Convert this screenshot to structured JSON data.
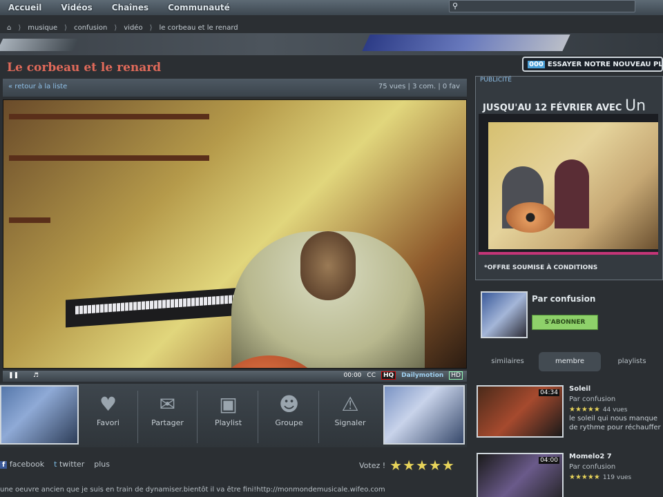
{
  "topnav": {
    "items": [
      "Accueil",
      "Vidéos",
      "Chaînes",
      "Communauté"
    ]
  },
  "search": {
    "placeholder": ""
  },
  "breadcrumb": [
    "musique",
    "confusion",
    "vidéo",
    "le corbeau et le renard"
  ],
  "video": {
    "title": "Le corbeau et le renard",
    "back_link": "« retour à la liste",
    "stats": "75 vues | 3 com. | 0 fav"
  },
  "player": {
    "time": "00:00",
    "cc": "CC",
    "hq": "HQ",
    "brand": "Dailymotion",
    "hd": "HD"
  },
  "actions": [
    {
      "label": "Favori",
      "icon": "heart-icon"
    },
    {
      "label": "Partager",
      "icon": "envelope-icon"
    },
    {
      "label": "Playlist",
      "icon": "playlist-icon"
    },
    {
      "label": "Groupe",
      "icon": "group-icon"
    },
    {
      "label": "Signaler",
      "icon": "warning-icon"
    }
  ],
  "social": {
    "facebook": "facebook",
    "twitter": "twitter",
    "plus": "plus"
  },
  "vote": {
    "label": "Votez !",
    "rating": 5
  },
  "description": "une oeuvre ancien que je suis en train de dynamiser.bientôt il va être fini!http://monmondemusicale.wifeo.com",
  "promo": {
    "tag": "000",
    "text": "ESSAYER NOTRE NOUVEAU PL"
  },
  "ad": {
    "label": "PUBLICITÉ",
    "headline": "JUSQU'AU 12 FÉVRIER AVEC",
    "brand": "Un",
    "footnote": "*OFFRE SOUMISE À CONDITIONS"
  },
  "owner": {
    "by": "Par confusion",
    "subscribe": "S'ABONNER"
  },
  "tabs": [
    {
      "label": "similaires",
      "active": false
    },
    {
      "label": "membre",
      "active": true
    },
    {
      "label": "playlists",
      "active": false
    }
  ],
  "related": [
    {
      "name": "Soleil",
      "by": "Par confusion",
      "views": "44 vues",
      "text": "le soleil qui nous manque",
      "text2": "de rythme pour réchauffer",
      "duration": "04:34"
    },
    {
      "name": "Momelo2 7",
      "by": "Par confusion",
      "views": "119 vues",
      "text": "",
      "text2": "",
      "duration": "04:00"
    }
  ]
}
